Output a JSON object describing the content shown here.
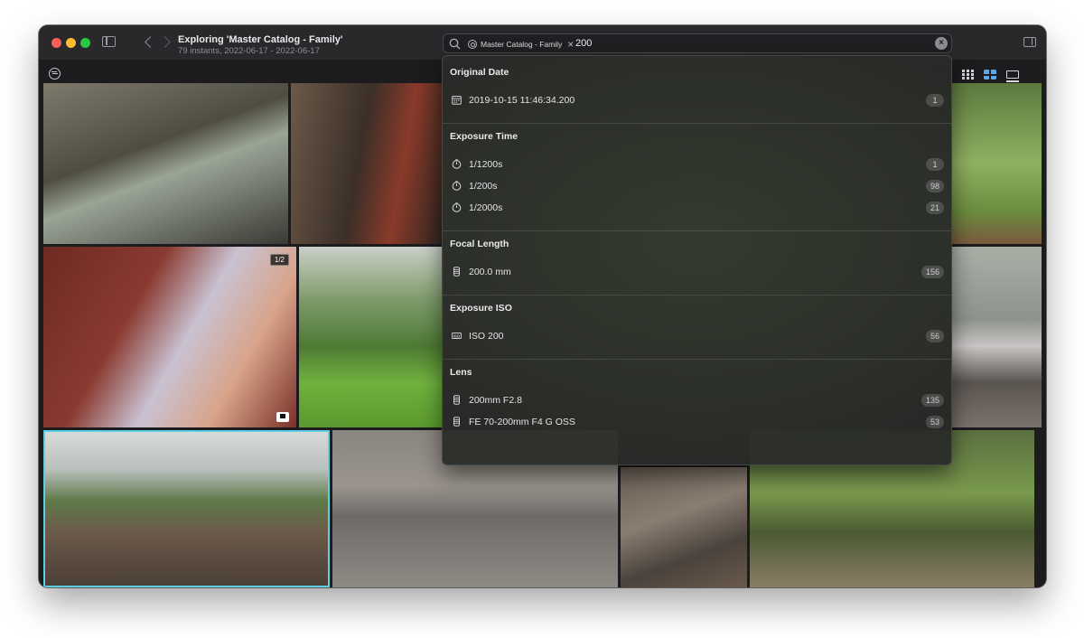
{
  "window": {
    "title": "Exploring 'Master Catalog - Family'",
    "subtitle": "79 instants, 2022-06-17 - 2022-06-17"
  },
  "search": {
    "token_label": "Master Catalog - Family",
    "query": "200"
  },
  "dropdown": {
    "sections": [
      {
        "title": "Original Date",
        "items": [
          {
            "icon": "calendar-icon",
            "label": "2019-10-15 11:46:34.200",
            "count": "1"
          }
        ]
      },
      {
        "title": "Exposure Time",
        "items": [
          {
            "icon": "timer-icon",
            "label": "1/1200s",
            "count": "1"
          },
          {
            "icon": "timer-icon",
            "label": "1/200s",
            "count": "98"
          },
          {
            "icon": "timer-icon",
            "label": "1/2000s",
            "count": "21"
          }
        ]
      },
      {
        "title": "Focal Length",
        "items": [
          {
            "icon": "lens-icon",
            "label": "200.0 mm",
            "count": "156"
          }
        ]
      },
      {
        "title": "Exposure ISO",
        "items": [
          {
            "icon": "iso-icon",
            "label": "ISO 200",
            "count": "56"
          }
        ]
      },
      {
        "title": "Lens",
        "items": [
          {
            "icon": "lens-icon",
            "label": "200mm F2.8",
            "count": "135"
          },
          {
            "icon": "lens-icon",
            "label": "FE 70-200mm F4 G OSS",
            "count": "53"
          }
        ]
      }
    ]
  },
  "grid": {
    "stack_badge": "1/2"
  },
  "colors": {
    "window_bg": "#1c1b1d",
    "accent": "#5aa9e6",
    "selection": "#5ccfe6"
  }
}
